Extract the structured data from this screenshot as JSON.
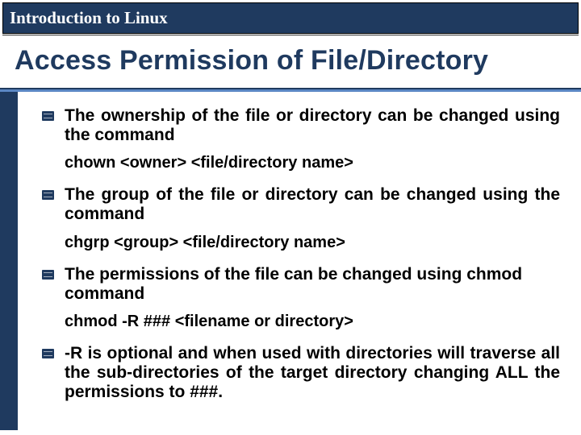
{
  "header": {
    "course_title": "Introduction to Linux"
  },
  "slide": {
    "title": "Access Permission of File/Directory",
    "items": [
      {
        "text": "The ownership of the file or directory can be changed using the command",
        "justify": true
      },
      {
        "command": "chown <owner> <file/directory  name>"
      },
      {
        "text": "The group of the file or directory can be changed using the command",
        "justify": true
      },
      {
        "command": "chgrp <group> <file/directory  name>"
      },
      {
        "text": "The permissions of the file can be changed using chmod command",
        "justify": false
      },
      {
        "command": "chmod -R ### <filename or directory>"
      },
      {
        "text": "-R is optional and when used with directories will traverse all the sub-directories of the target directory changing ALL the permissions to ###.",
        "justify": true
      }
    ]
  }
}
